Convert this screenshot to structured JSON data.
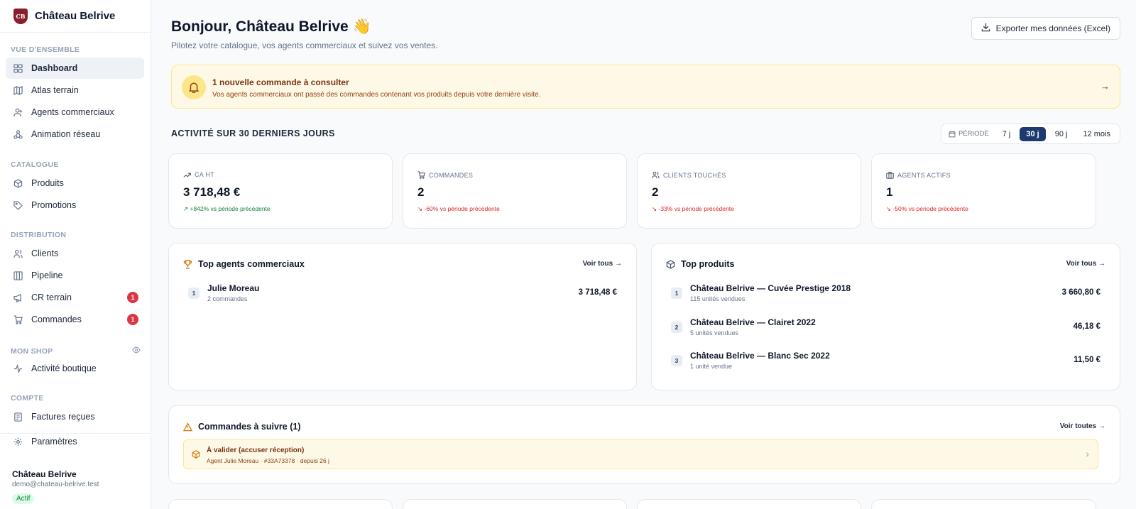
{
  "brand": {
    "logo_text": "CB",
    "name": "Château Belrive"
  },
  "sidebar": {
    "sections": {
      "overview": "VUE D'ENSEMBLE",
      "catalogue": "CATALOGUE",
      "distribution": "DISTRIBUTION",
      "shop": "MON SHOP",
      "account": "COMPTE"
    },
    "items": {
      "dashboard": "Dashboard",
      "atlas": "Atlas terrain",
      "agents": "Agents commerciaux",
      "animation": "Animation réseau",
      "produits": "Produits",
      "promotions": "Promotions",
      "clients": "Clients",
      "pipeline": "Pipeline",
      "cr_terrain": "CR terrain",
      "cr_terrain_badge": "1",
      "commandes": "Commandes",
      "commandes_badge": "1",
      "activite": "Activité boutique",
      "factures": "Factures reçues",
      "parametres": "Paramètres"
    },
    "user": {
      "name": "Château Belrive",
      "email": "demo@chateau-belrive.test",
      "status": "Actif"
    }
  },
  "header": {
    "greeting": "Bonjour, Château Belrive 👋",
    "subtitle": "Pilotez votre catalogue, vos agents commerciaux et suivez vos ventes.",
    "export_label": "Exporter mes données (Excel)"
  },
  "alert": {
    "title": "1 nouvelle commande à consulter",
    "text": "Vos agents commerciaux ont passé des commandes contenant vos produits depuis votre dernière visite."
  },
  "activity": {
    "title": "Activité sur 30 derniers jours",
    "period_label": "PÉRIODE",
    "periods": [
      "7 j",
      "30 j",
      "90 j",
      "12 mois"
    ],
    "selected_period": "30 j"
  },
  "kpis": [
    {
      "label": "CA HT",
      "value": "3 718,48 €",
      "delta": "+842% vs période précédente",
      "trend": "up"
    },
    {
      "label": "Commandes",
      "value": "2",
      "delta": "-60% vs période précédente",
      "trend": "down"
    },
    {
      "label": "Clients touchés",
      "value": "2",
      "delta": "-33% vs période précédente",
      "trend": "down"
    },
    {
      "label": "Agents actifs",
      "value": "1",
      "delta": "-50% vs période précédente",
      "trend": "down"
    }
  ],
  "top_agents": {
    "title": "Top agents commerciaux",
    "link": "Voir tous →",
    "rows": [
      {
        "rank": "1",
        "name": "Julie Moreau",
        "sub": "2 commandes",
        "value": "3 718,48 €"
      }
    ]
  },
  "top_products": {
    "title": "Top produits",
    "link": "Voir tous →",
    "rows": [
      {
        "rank": "1",
        "name": "Château Belrive — Cuvée Prestige 2018",
        "sub": "115 unités vendues",
        "value": "3 660,80 €"
      },
      {
        "rank": "2",
        "name": "Château Belrive — Clairet 2022",
        "sub": "5 unités vendues",
        "value": "46,18 €"
      },
      {
        "rank": "3",
        "name": "Château Belrive — Blanc Sec 2022",
        "sub": "1 unité vendue",
        "value": "11,50 €"
      }
    ]
  },
  "follow": {
    "title": "Commandes à suivre (1)",
    "link": "Voir toutes →",
    "item_title": "À valider (accuser réception)",
    "item_sub": "Agent Julie Moreau · #33A73378 · depuis 26 j"
  },
  "colors": {
    "accent": "#1e3a6e",
    "brand": "#8b1e2c",
    "alert_bg": "#fef9e7",
    "up": "#15803d",
    "down": "#dc2626"
  }
}
